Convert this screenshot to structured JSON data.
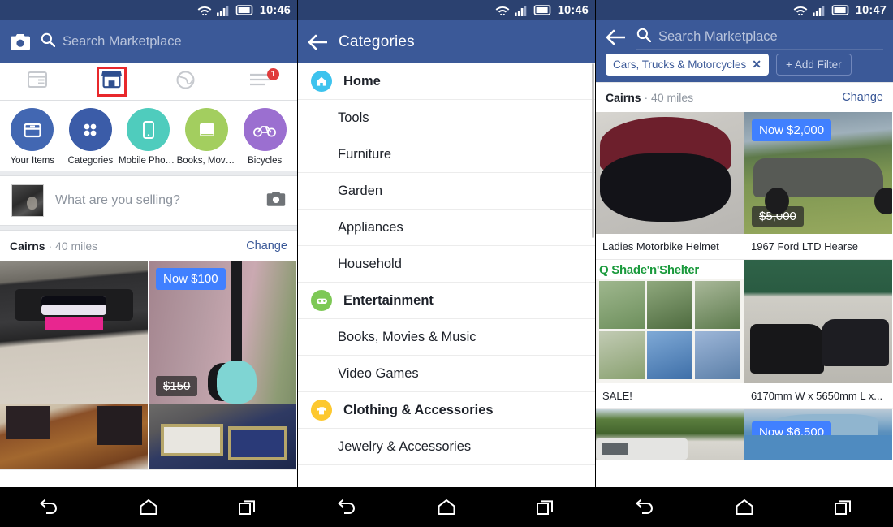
{
  "panel1": {
    "status": {
      "time": "10:46",
      "icons": [
        "wifi-icon",
        "signal-icon",
        "battery-icon"
      ]
    },
    "header": {
      "camera_icon": "camera-icon",
      "search_icon": "search-icon",
      "search_placeholder": "Search Marketplace"
    },
    "tabs": [
      {
        "name": "news-feed-tab",
        "icon": "news-feed-icon",
        "selected": false
      },
      {
        "name": "marketplace-tab",
        "icon": "marketplace-storefront-icon",
        "selected": true
      },
      {
        "name": "notifications-tab",
        "icon": "globe-icon",
        "selected": false
      },
      {
        "name": "menu-tab",
        "icon": "hamburger-menu-icon",
        "selected": false,
        "badge": "1"
      }
    ],
    "categories": [
      {
        "label": "Your Items",
        "icon": "box-icon",
        "color": "#4267B2"
      },
      {
        "label": "Categories",
        "icon": "grid-dots-icon",
        "color": "#3B5CA8"
      },
      {
        "label": "Mobile Phones",
        "icon": "phone-icon",
        "color": "#4FCCBD"
      },
      {
        "label": "Books, Movie...",
        "icon": "book-icon",
        "color": "#A3CE5F"
      },
      {
        "label": "Bicycles",
        "icon": "bicycle-icon",
        "color": "#9B6FD0"
      }
    ],
    "composer": {
      "placeholder": "What are you selling?",
      "camera_icon": "camera-icon",
      "avatar": "user-avatar"
    },
    "location": {
      "city": "Cairns",
      "separator": "·",
      "radius": "40 miles",
      "change": "Change"
    },
    "listings": [
      {
        "title": "",
        "price_now": "",
        "price_old": "",
        "image": "treadmill-photo"
      },
      {
        "title": "",
        "price_now": "Now $100",
        "price_old": "$150",
        "image": "guitar-photo"
      },
      {
        "title": "",
        "price_now": "",
        "price_old": "",
        "image": "dining-table-photo"
      },
      {
        "title": "",
        "price_now": "",
        "price_old": "",
        "image": "framed-prints-photo"
      }
    ]
  },
  "panel2": {
    "status": {
      "time": "10:46"
    },
    "header": {
      "back_icon": "back-arrow-icon",
      "title": "Categories"
    },
    "rows": [
      {
        "label": "Home",
        "type": "section",
        "icon": "home-icon",
        "color": "#3DC3EE"
      },
      {
        "label": "Tools",
        "type": "item"
      },
      {
        "label": "Furniture",
        "type": "item"
      },
      {
        "label": "Garden",
        "type": "item"
      },
      {
        "label": "Appliances",
        "type": "item"
      },
      {
        "label": "Household",
        "type": "item"
      },
      {
        "label": "Entertainment",
        "type": "section",
        "icon": "gamepad-icon",
        "color": "#7DC855"
      },
      {
        "label": "Books, Movies & Music",
        "type": "item"
      },
      {
        "label": "Video Games",
        "type": "item"
      },
      {
        "label": "Clothing & Accessories",
        "type": "section",
        "icon": "clothing-icon",
        "color": "#FDC82F"
      },
      {
        "label": "Jewelry & Accessories",
        "type": "item"
      }
    ]
  },
  "panel3": {
    "status": {
      "time": "10:47"
    },
    "header": {
      "back_icon": "back-arrow-icon",
      "search_icon": "search-icon",
      "search_placeholder": "Search Marketplace"
    },
    "filters": {
      "active": "Cars, Trucks & Motorcycles",
      "remove_icon": "close-x-icon",
      "add": "+ Add Filter"
    },
    "location": {
      "city": "Cairns",
      "separator": "·",
      "radius": "40 miles",
      "change": "Change"
    },
    "listings": [
      {
        "title": "Ladies Motorbike Helmet",
        "price_now": "",
        "price_old": "",
        "image": "motorbike-helmet-photo"
      },
      {
        "title": "1967 Ford LTD Hearse",
        "price_now": "Now $2,000",
        "price_old": "$5,000",
        "image": "hearse-photo"
      },
      {
        "title": "SALE!",
        "price_now": "",
        "price_old": "",
        "image": "shade-shelter-flyer-photo"
      },
      {
        "title": "6170mm W x 5650mm L x...",
        "price_now": "",
        "price_old": "",
        "image": "carport-photo"
      },
      {
        "title": "",
        "price_now": "",
        "price_old": "",
        "image": "white-van-photo"
      },
      {
        "title": "",
        "price_now": "Now $6,500",
        "price_old": "",
        "image": "blue-car-photo"
      }
    ]
  },
  "navbar": {
    "back": "back-nav-icon",
    "home": "home-nav-icon",
    "recents": "recents-nav-icon"
  },
  "colors": {
    "facebook_blue": "#3b5998",
    "statusbar_blue": "#2b4170",
    "price_blue": "#4080ff",
    "badge_red": "#e03c3c",
    "selection_red": "#e8282b"
  }
}
